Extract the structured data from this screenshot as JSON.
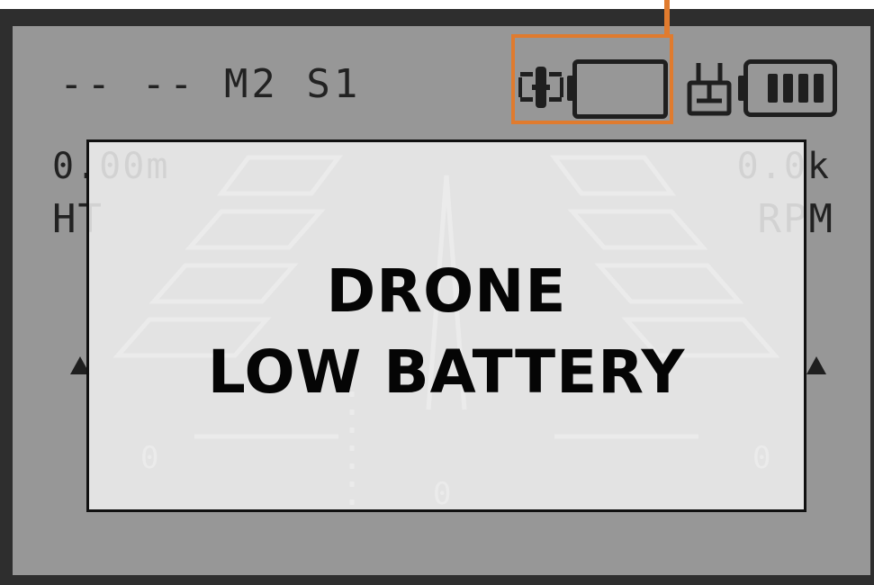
{
  "status_bar": {
    "mode_line": "-- -- M2 S1"
  },
  "telemetry": {
    "height_value": "0.00m",
    "height_label": "HT",
    "rpm_value": "0.0k",
    "rpm_label": "RPM"
  },
  "trims": {
    "left": "0",
    "right": "0",
    "center": "0"
  },
  "alert": {
    "line1": "DRONE",
    "line2": "LOW BATTERY"
  },
  "icons": {
    "drone": "drone-icon",
    "drone_battery": "drone-battery-icon",
    "transmitter": "transmitter-icon",
    "transmitter_battery": "transmitter-battery-icon"
  },
  "battery": {
    "drone_level_fraction": 0,
    "transmitter_level_fraction": 1
  },
  "colors": {
    "lcd_background": "#979797",
    "lcd_text": "#222222",
    "highlight": "#e07b2e",
    "alert_text": "#050505"
  }
}
